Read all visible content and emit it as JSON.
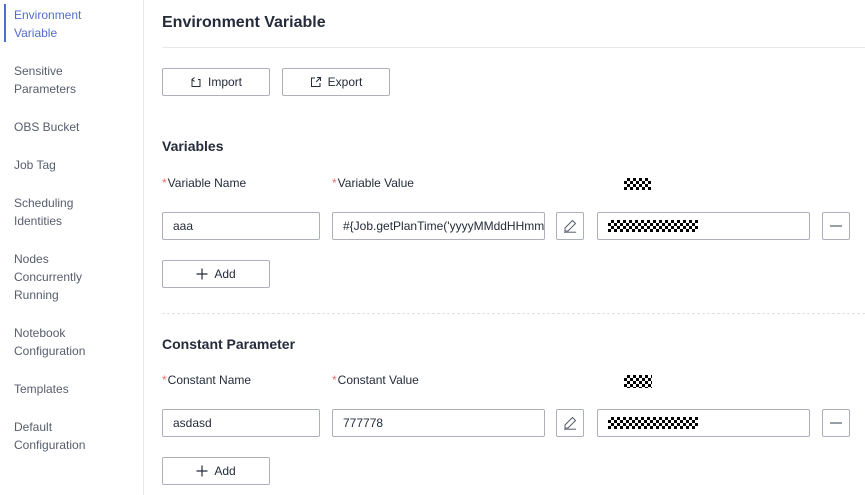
{
  "sidebar": {
    "items": [
      {
        "line1": "Environment",
        "line2": "Variable"
      },
      {
        "line1": "Sensitive",
        "line2": "Parameters"
      },
      {
        "line1": "OBS Bucket",
        "line2": ""
      },
      {
        "line1": "Job Tag",
        "line2": ""
      },
      {
        "line1": "Scheduling",
        "line2": "Identities"
      },
      {
        "line1": "Nodes",
        "line2": "Concurrently",
        "line3": "Running"
      },
      {
        "line1": "Notebook",
        "line2": "Configuration"
      },
      {
        "line1": "Templates",
        "line2": ""
      },
      {
        "line1": "Default",
        "line2": "Configuration"
      }
    ],
    "active_index": 0,
    "accent_color": "#526ecc"
  },
  "main": {
    "title": "Environment Variable",
    "toolbar": {
      "import_label": "Import",
      "export_label": "Export"
    },
    "variables": {
      "section_title": "Variables",
      "name_label": "Variable Name",
      "value_label": "Variable Value",
      "required_mark": "*",
      "row": {
        "name": "aaa",
        "value": "#{Job.getPlanTime('yyyyMMddHHmm"
      },
      "add_label": "Add"
    },
    "constants": {
      "section_title": "Constant Parameter",
      "name_label": "Constant Name",
      "value_label": "Constant Value",
      "required_mark": "*",
      "row": {
        "name": "asdasd",
        "value": "777778"
      },
      "add_label": "Add"
    },
    "required_color": "#f66f6a"
  },
  "icons": {
    "import": "import-icon",
    "export": "export-icon",
    "edit": "edit-icon",
    "remove": "minus-icon",
    "add": "plus-icon"
  }
}
